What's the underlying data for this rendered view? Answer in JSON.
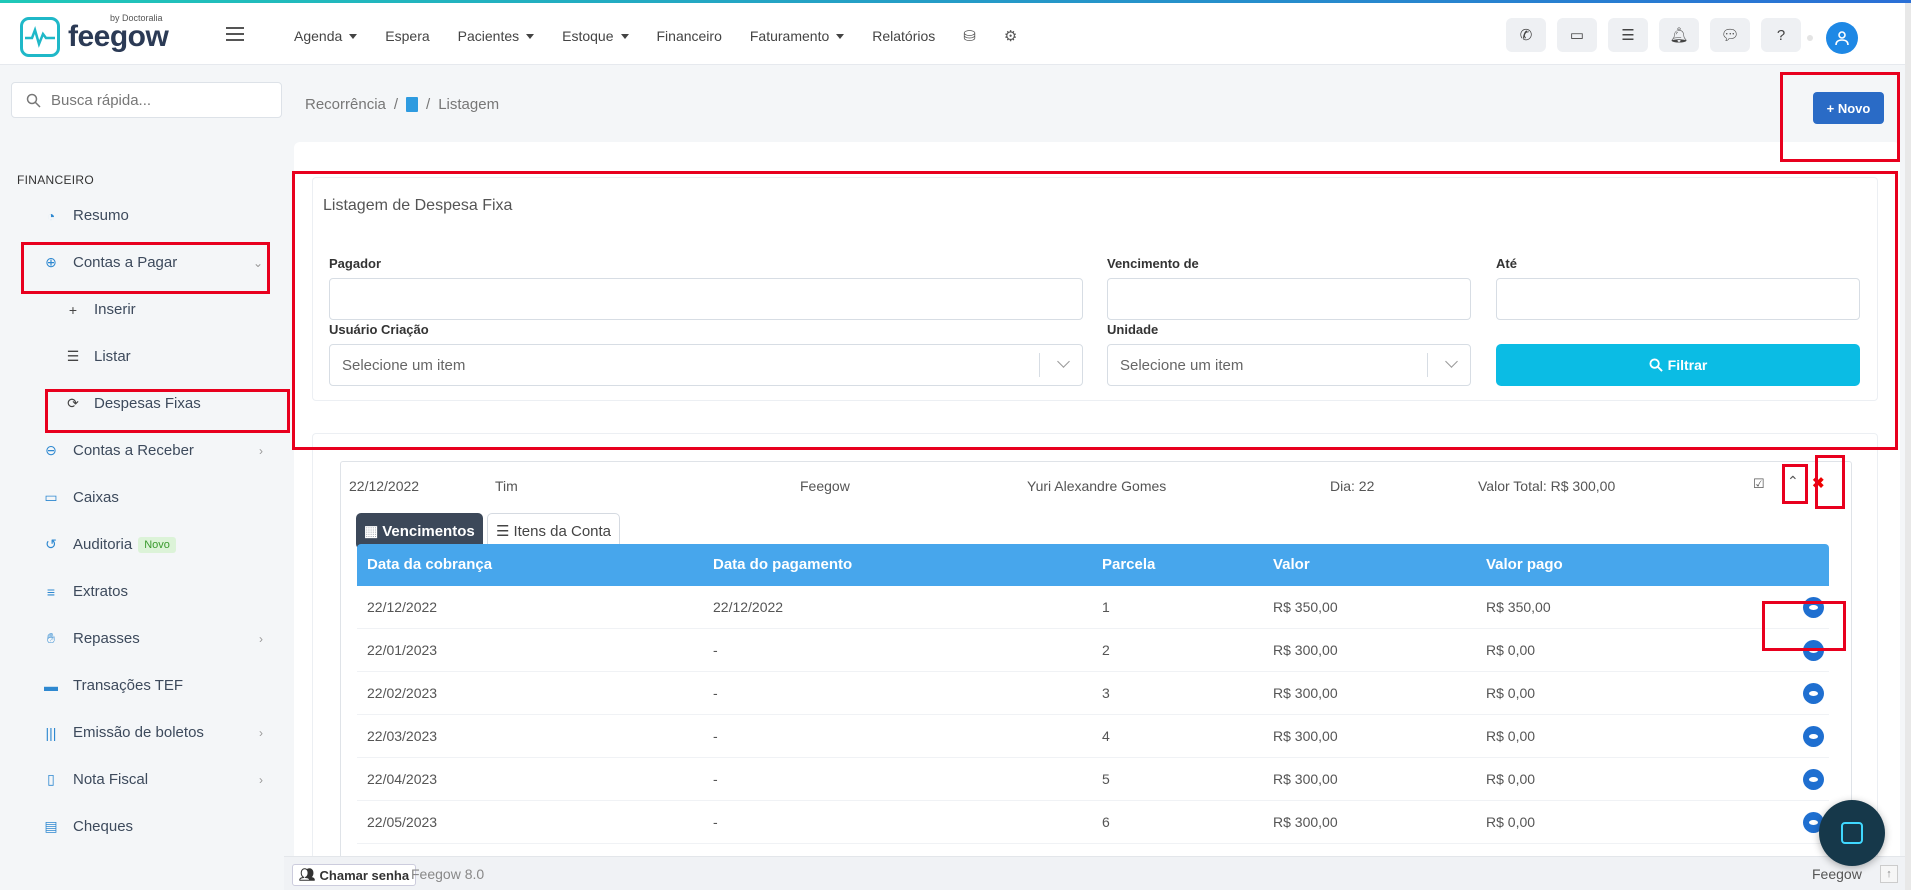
{
  "brand": {
    "name": "feegow",
    "by": "by Doctoralia"
  },
  "nav": [
    {
      "label": "Agenda",
      "caret": true
    },
    {
      "label": "Espera",
      "caret": false
    },
    {
      "label": "Pacientes",
      "caret": true
    },
    {
      "label": "Estoque",
      "caret": true
    },
    {
      "label": "Financeiro",
      "caret": false
    },
    {
      "label": "Faturamento",
      "caret": true
    },
    {
      "label": "Relatórios",
      "caret": false
    }
  ],
  "nav_icons": [
    "database-icon",
    "gear-icon"
  ],
  "top_icons": [
    "phone-icon",
    "inbox-icon",
    "checklist-icon",
    "bell-icon",
    "chat-icon",
    "help-icon"
  ],
  "search": {
    "placeholder": "Busca rápida..."
  },
  "sidebar": {
    "section": "FINANCEIRO",
    "items": {
      "resumo": "Resumo",
      "contas_pagar": "Contas a Pagar",
      "inserir": "Inserir",
      "listar": "Listar",
      "despesas_fixas": "Despesas Fixas",
      "contas_receber": "Contas a Receber",
      "caixas": "Caixas",
      "auditoria": "Auditoria",
      "auditoria_badge": "Novo",
      "extratos": "Extratos",
      "repasses": "Repasses",
      "tef": "Transações TEF",
      "boletos": "Emissão de boletos",
      "nota_fiscal": "Nota Fiscal",
      "cheques": "Cheques"
    }
  },
  "breadcrumb": {
    "first": "Recorrência",
    "sep": "/",
    "last": "Listagem"
  },
  "novo_button": "+ Novo",
  "filter": {
    "title": "Listagem de Despesa Fixa",
    "pagador_label": "Pagador",
    "venc_de_label": "Vencimento de",
    "ate_label": "Até",
    "usuario_label": "Usuário Criação",
    "usuario_placeholder": "Selecione um item",
    "unidade_label": "Unidade",
    "unidade_placeholder": "Selecione um item",
    "filtrar_button": "Filtrar"
  },
  "record": {
    "date": "22/12/2022",
    "name": "Tim",
    "company": "Feegow",
    "person": "Yuri Alexandre Gomes",
    "day": "Dia: 22",
    "total": "Valor Total: R$ 300,00"
  },
  "tabs": {
    "vencimentos": "Vencimentos",
    "itens": "Itens da Conta"
  },
  "table": {
    "headers": [
      "Data da cobrança",
      "Data do pagamento",
      "Parcela",
      "Valor",
      "Valor pago"
    ],
    "rows": [
      [
        "22/12/2022",
        "22/12/2022",
        "1",
        "R$ 350,00",
        "R$ 350,00"
      ],
      [
        "22/01/2023",
        "-",
        "2",
        "R$ 300,00",
        "R$ 0,00"
      ],
      [
        "22/02/2023",
        "-",
        "3",
        "R$ 300,00",
        "R$ 0,00"
      ],
      [
        "22/03/2023",
        "-",
        "4",
        "R$ 300,00",
        "R$ 0,00"
      ],
      [
        "22/04/2023",
        "-",
        "5",
        "R$ 300,00",
        "R$ 0,00"
      ],
      [
        "22/05/2023",
        "-",
        "6",
        "R$ 300,00",
        "R$ 0,00"
      ]
    ]
  },
  "footer": {
    "chamar": "Chamar senha",
    "version": "Feegow 8.0",
    "brand": "Feegow"
  },
  "colors": {
    "primary": "#2a6bc6",
    "filter_button": "#0bbce4",
    "table_header": "#47a6ec",
    "highlight": "#e8001e"
  }
}
